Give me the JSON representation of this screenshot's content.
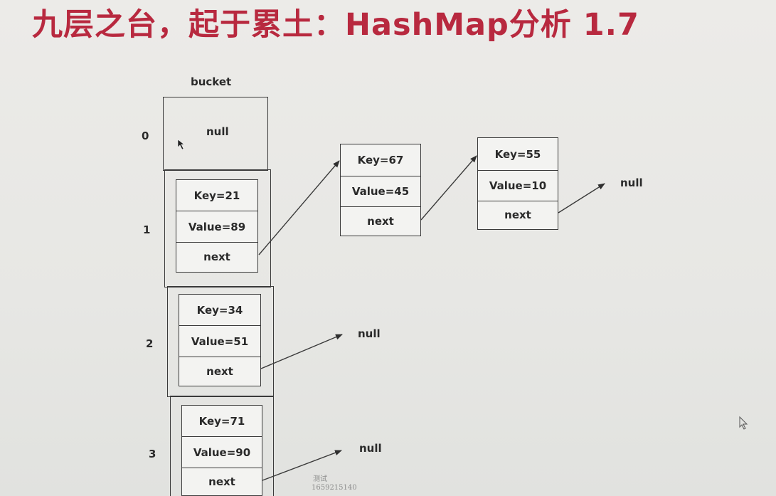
{
  "title": "九层之台，起于累土：HashMap分析 1.7",
  "title_color": "#b8293f",
  "bucket_label": "bucket",
  "null_label": "null",
  "indices": [
    "0",
    "1",
    "2",
    "3"
  ],
  "buckets": [
    {
      "key": "Key=21",
      "value": "Value=89",
      "next": "next"
    },
    {
      "key": "Key=34",
      "value": "Value=51",
      "next": "next"
    },
    {
      "key": "Key=71",
      "value": "Value=90",
      "next": "next"
    }
  ],
  "chain": [
    {
      "key": "Key=67",
      "value": "Value=45",
      "next": "next"
    },
    {
      "key": "Key=55",
      "value": "Value=10",
      "next": "next"
    }
  ],
  "watermark": {
    "line1": "测试",
    "line2": "1659215140"
  }
}
